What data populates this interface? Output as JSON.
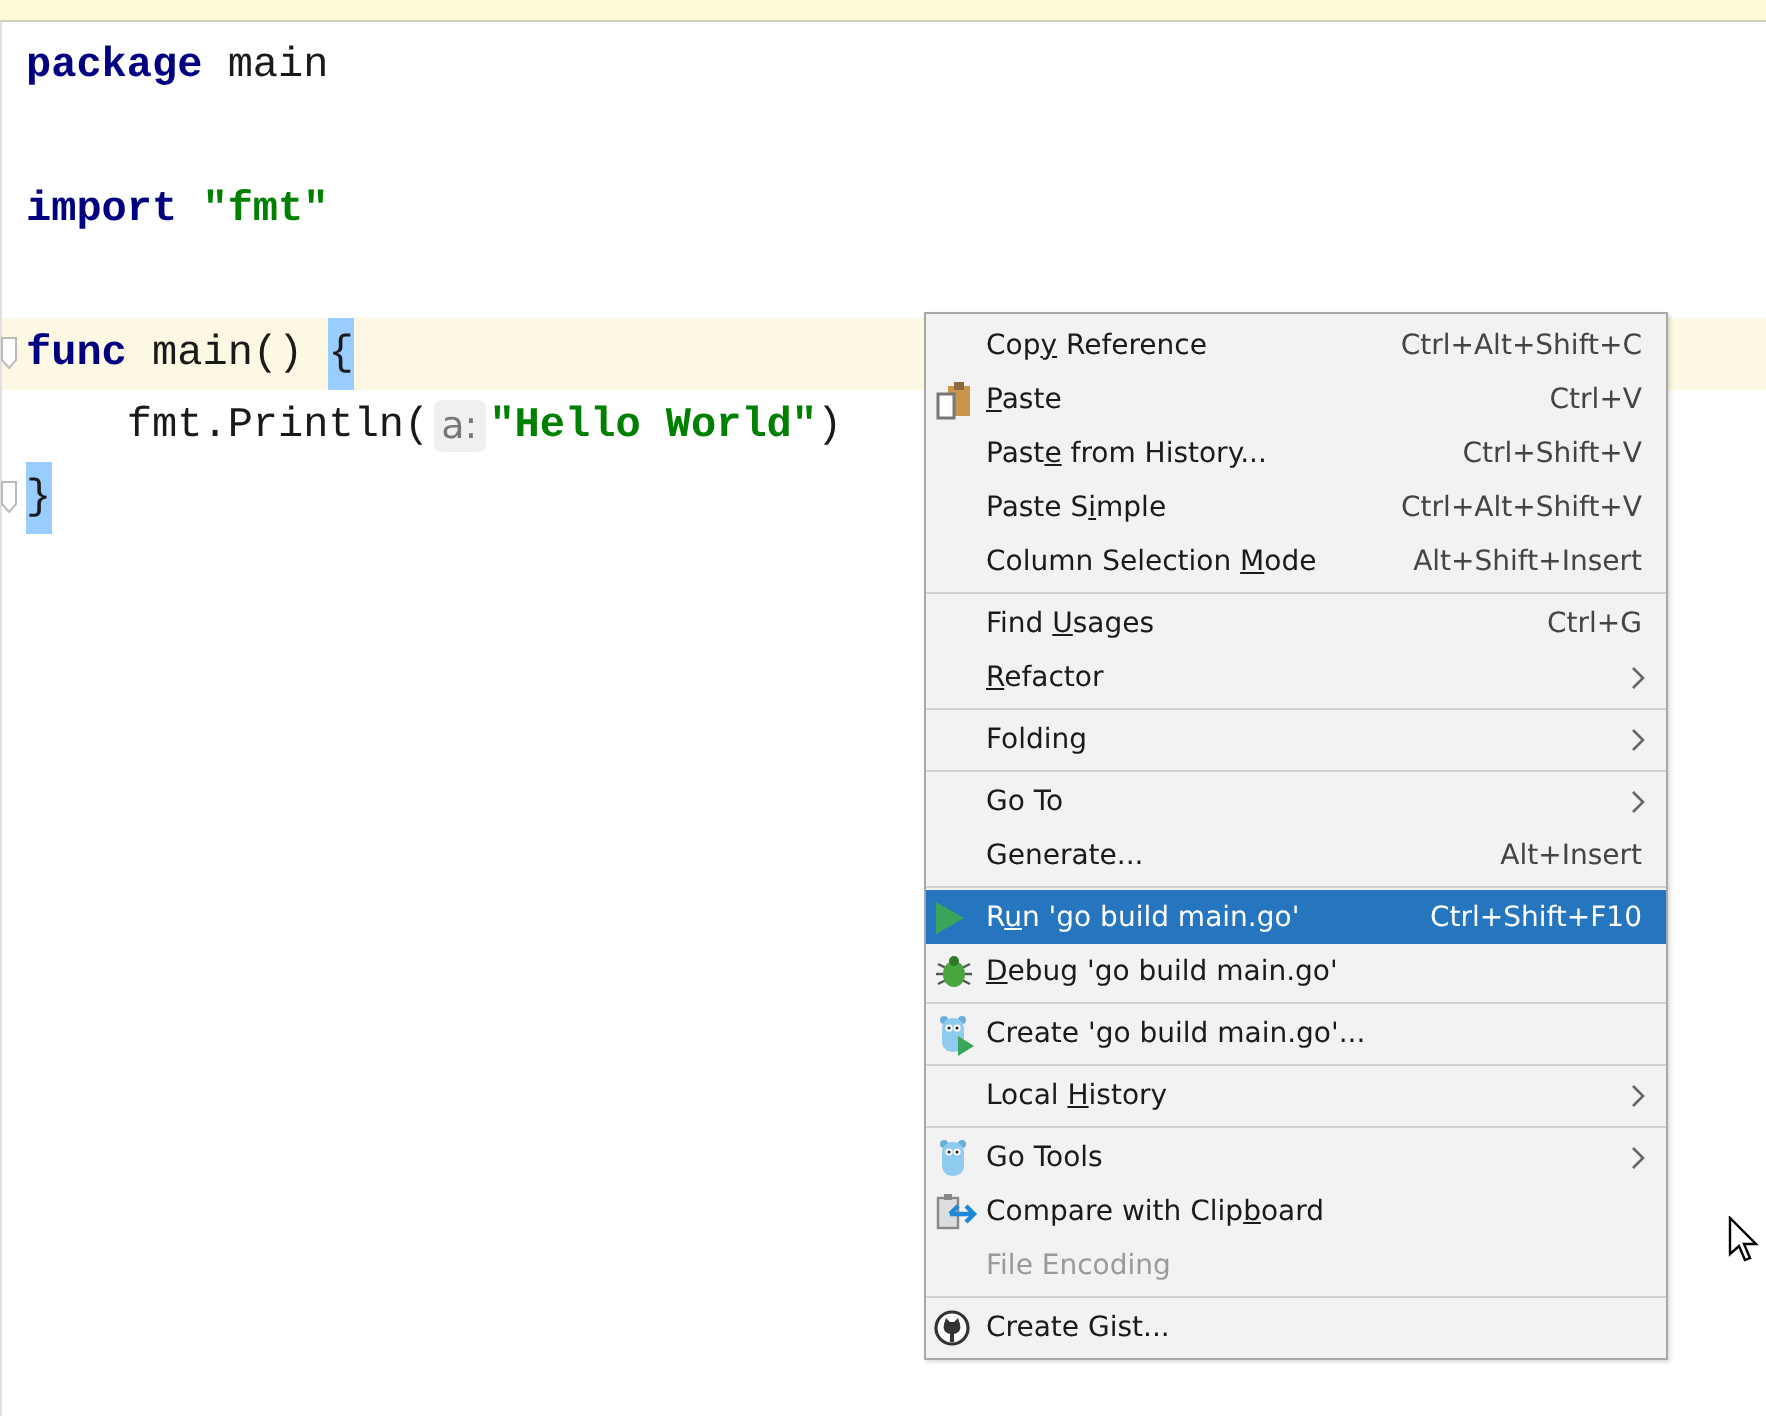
{
  "editor": {
    "lines": [
      {
        "kind": "code",
        "tokens": [
          {
            "kind": "keyword",
            "text": "package"
          },
          {
            "kind": "plain",
            "text": " main"
          }
        ]
      },
      {
        "kind": "blank"
      },
      {
        "kind": "code",
        "tokens": [
          {
            "kind": "keyword",
            "text": "import"
          },
          {
            "kind": "string",
            "text": " \"fmt\""
          }
        ]
      },
      {
        "kind": "blank"
      },
      {
        "kind": "code",
        "current": true,
        "fold": true,
        "tokens": [
          {
            "kind": "keyword",
            "text": "func"
          },
          {
            "kind": "plain",
            "text": " main() "
          },
          {
            "kind": "brace",
            "text": "{"
          }
        ]
      },
      {
        "kind": "code",
        "tokens": [
          {
            "kind": "plain",
            "text": "    fmt.Println("
          },
          {
            "kind": "hint",
            "text": "a:"
          },
          {
            "kind": "string",
            "text": "\"Hello World\""
          },
          {
            "kind": "plain",
            "text": ")"
          }
        ]
      },
      {
        "kind": "code",
        "fold": true,
        "tokens": [
          {
            "kind": "brace",
            "text": "}"
          }
        ]
      }
    ]
  },
  "context_menu": {
    "items": [
      {
        "kind": "item",
        "before": "Cop",
        "mnemonic": "y",
        "after": " Reference",
        "shortcut": "Ctrl+Alt+Shift+C",
        "selected": false,
        "disabled": false
      },
      {
        "kind": "item",
        "mnemonic": "P",
        "after": "aste",
        "shortcut": "Ctrl+V",
        "selected": false,
        "disabled": false
      },
      {
        "kind": "item",
        "before": "Past",
        "mnemonic": "e",
        "after": " from History...",
        "shortcut": "Ctrl+Shift+V",
        "selected": false,
        "disabled": false
      },
      {
        "kind": "item",
        "before": "Paste S",
        "mnemonic": "i",
        "after": "mple",
        "shortcut": "Ctrl+Alt+Shift+V",
        "selected": false,
        "disabled": false
      },
      {
        "kind": "item",
        "before": "Column Selection ",
        "mnemonic": "M",
        "after": "ode",
        "shortcut": "Alt+Shift+Insert",
        "selected": false,
        "disabled": false
      },
      {
        "kind": "separator"
      },
      {
        "kind": "item",
        "before": "Find ",
        "mnemonic": "U",
        "after": "sages",
        "shortcut": "Ctrl+G",
        "selected": false,
        "disabled": false
      },
      {
        "kind": "item",
        "mnemonic": "R",
        "after": "efactor",
        "submenu": true,
        "selected": false,
        "disabled": false
      },
      {
        "kind": "separator"
      },
      {
        "kind": "item",
        "before": "Folding",
        "submenu": true,
        "selected": false,
        "disabled": false
      },
      {
        "kind": "separator"
      },
      {
        "kind": "item",
        "before": "Go To",
        "submenu": true,
        "selected": false,
        "disabled": false
      },
      {
        "kind": "item",
        "before": "Generate...",
        "shortcut": "Alt+Insert",
        "selected": false,
        "disabled": false
      },
      {
        "kind": "separator"
      },
      {
        "kind": "item",
        "before": "R",
        "mnemonic": "u",
        "after": "n 'go build main.go'",
        "shortcut": "Ctrl+Shift+F10",
        "selected": true,
        "disabled": false
      },
      {
        "kind": "item",
        "mnemonic": "D",
        "after": "ebug 'go build main.go'",
        "selected": false,
        "disabled": false
      },
      {
        "kind": "separator"
      },
      {
        "kind": "item",
        "before": "Create 'go build main.go'...",
        "selected": false,
        "disabled": false
      },
      {
        "kind": "separator"
      },
      {
        "kind": "item",
        "before": "Local ",
        "mnemonic": "H",
        "after": "istory",
        "submenu": true,
        "selected": false,
        "disabled": false
      },
      {
        "kind": "separator"
      },
      {
        "kind": "item",
        "before": "Go Tools",
        "submenu": true,
        "selected": false,
        "disabled": false
      },
      {
        "kind": "item",
        "before": "Compare with Clip",
        "mnemonic": "b",
        "after": "oard",
        "selected": false,
        "disabled": false
      },
      {
        "kind": "item",
        "before": "File Encoding",
        "selected": false,
        "disabled": true
      },
      {
        "kind": "separator"
      },
      {
        "kind": "item",
        "before": "Create Gist...",
        "selected": false,
        "disabled": false
      }
    ]
  }
}
